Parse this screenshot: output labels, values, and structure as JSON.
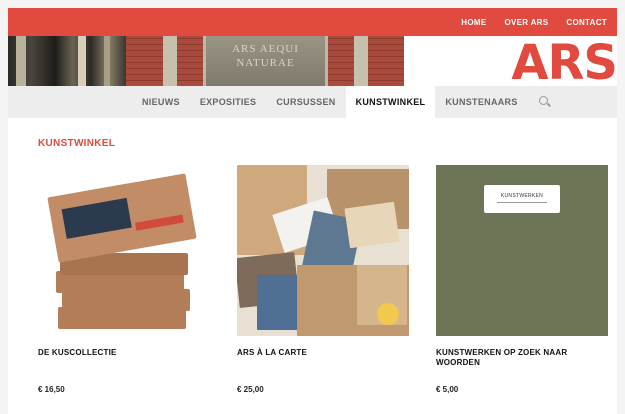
{
  "topnav": {
    "items": [
      "HOME",
      "OVER ARS",
      "CONTACT"
    ]
  },
  "banner": {
    "building_text_1": "ARS AEQUI",
    "building_text_2": "NATURAE",
    "brand": "ARS"
  },
  "mainnav": {
    "items": [
      "NIEUWS",
      "EXPOSITIES",
      "CURSUSSEN",
      "KUNSTWINKEL",
      "KUNSTENAARS"
    ],
    "active": "KUNSTWINKEL"
  },
  "page": {
    "title": "KUNSTWINKEL"
  },
  "products": [
    {
      "name": "DE KUSCOLLECTIE",
      "price": "€ 16,50"
    },
    {
      "name": "ARS À LA CARTE",
      "price": "€ 25,00"
    },
    {
      "name": "KUNSTWERKEN OP ZOEK NAAR WOORDEN",
      "price": "€ 5,00"
    }
  ],
  "product3_cover": "KUNSTWERKEN",
  "colors": {
    "accent": "#e04a3f",
    "nav_bg": "#ededed",
    "cover_green": "#6c7556"
  },
  "icons": [
    "search-icon"
  ]
}
